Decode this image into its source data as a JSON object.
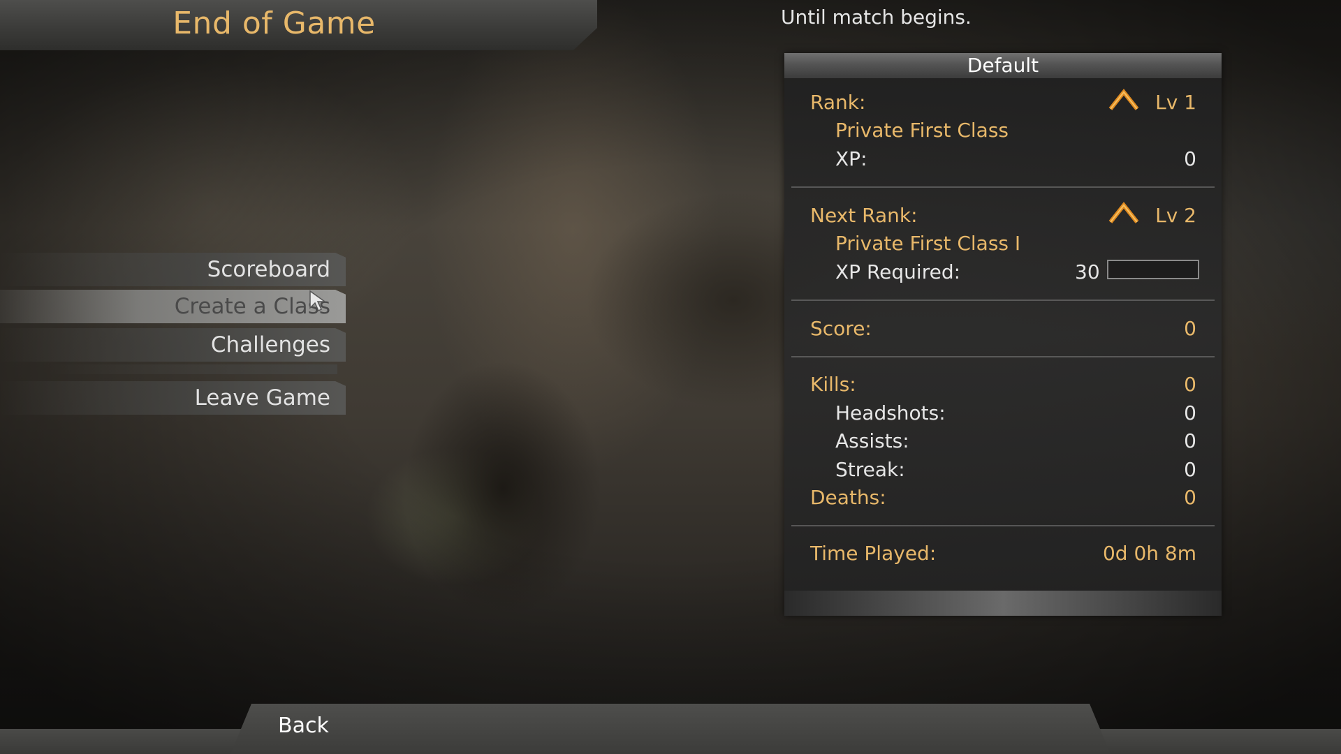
{
  "header": {
    "title": "End of Game"
  },
  "countdown": {
    "text": "Until match begins."
  },
  "menu": {
    "items": [
      {
        "label": "Scoreboard"
      },
      {
        "label": "Create a Class"
      },
      {
        "label": "Challenges"
      },
      {
        "label": "Leave Game"
      }
    ]
  },
  "stats": {
    "header": "Default",
    "rank": {
      "label": "Rank:",
      "level": "Lv 1",
      "title": "Private First Class",
      "xp_label": "XP:",
      "xp_value": "0"
    },
    "next_rank": {
      "label": "Next Rank:",
      "level": "Lv 2",
      "title": "Private First Class I",
      "xp_required_label": "XP Required:",
      "xp_required_value": "30",
      "xp_progress": 0
    },
    "score": {
      "label": "Score:",
      "value": "0"
    },
    "kills": {
      "label": "Kills:",
      "value": "0"
    },
    "headshots": {
      "label": "Headshots:",
      "value": "0"
    },
    "assists": {
      "label": "Assists:",
      "value": "0"
    },
    "streak": {
      "label": "Streak:",
      "value": "0"
    },
    "deaths": {
      "label": "Deaths:",
      "value": "0"
    },
    "time_played": {
      "label": "Time Played:",
      "value": "0d 0h 8m"
    }
  },
  "footer": {
    "back_label": "Back"
  },
  "icons": {
    "rank": "chevron-rank-icon",
    "cursor": "cursor-icon"
  },
  "colors": {
    "gold": "#e8b86a",
    "white": "#e6e6e6",
    "rank_icon": "#e08a20"
  }
}
